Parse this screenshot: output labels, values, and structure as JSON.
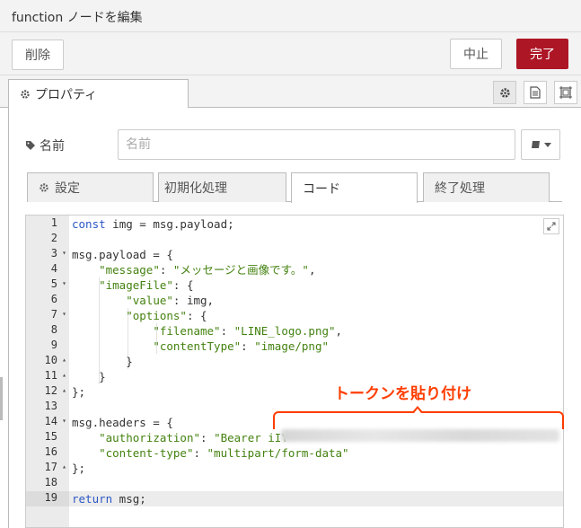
{
  "window": {
    "title": "function ノードを編集"
  },
  "toolbar": {
    "delete_label": "削除",
    "cancel_label": "中止",
    "done_label": "完了"
  },
  "tabs": {
    "properties_label": "プロパティ"
  },
  "form": {
    "name_label": "名前",
    "name_placeholder": "名前",
    "name_value": ""
  },
  "subtabs": [
    {
      "label": "設定"
    },
    {
      "label": "初期化処理"
    },
    {
      "label": "コード"
    },
    {
      "label": "終了処理"
    }
  ],
  "editor": {
    "line_numbers": [
      "1",
      "2",
      "3",
      "4",
      "5",
      "6",
      "7",
      "8",
      "9",
      "10",
      "11",
      "12",
      "13",
      "14",
      "15",
      "16",
      "17",
      "18",
      "19"
    ],
    "current_line": 19,
    "line_count": 19
  },
  "annotation": {
    "callout_text": "トークンを貼り付け"
  },
  "colors": {
    "accent": "#ad1625",
    "callout": "#ff3d00",
    "keyword": "#2b57c5",
    "string": "#448210"
  }
}
